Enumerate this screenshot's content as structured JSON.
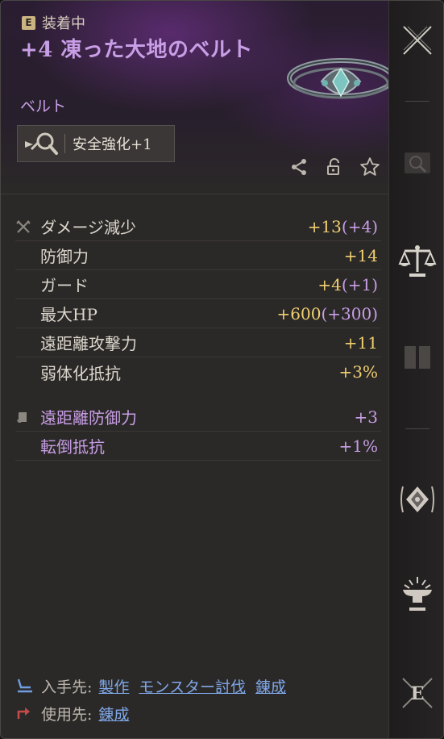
{
  "header": {
    "equipped_badge": "E",
    "equipped_label": "装着中",
    "item_name": "+4 凍った大地のベルト",
    "category": "ベルト",
    "enhance_label": "安全強化+1"
  },
  "action_icons": [
    "share-icon",
    "unlock-icon",
    "favorite-star-icon"
  ],
  "stats": [
    {
      "label": "ダメージ減少",
      "value": "+13",
      "bonus": "(+4)",
      "icon": "crossed-swords-icon"
    },
    {
      "label": "防御力",
      "value": "+14",
      "bonus": ""
    },
    {
      "label": "ガード",
      "value": "+4",
      "bonus": "(+1)"
    },
    {
      "label": "最大HP",
      "value": "+600",
      "bonus": "(+300)"
    },
    {
      "label": "遠距離攻撃力",
      "value": "+11",
      "bonus": ""
    },
    {
      "label": "弱体化抵抗",
      "value": "+3%",
      "bonus": ""
    }
  ],
  "sub_stats": [
    {
      "label": "遠距離防御力",
      "value": "+3",
      "icon": "scroll-icon"
    },
    {
      "label": "転倒抵抗",
      "value": "+1%"
    }
  ],
  "footer": {
    "source_label": "入手先:",
    "source_links": [
      "製作",
      "モンスター討伐",
      "錬成"
    ],
    "use_label": "使用先:",
    "use_links": [
      "錬成"
    ]
  },
  "sidebar_icons": [
    "close-icon",
    "search-icon",
    "compare-scales-icon",
    "book-icon",
    "cube-icon",
    "anvil-icon",
    "equip-e-icon"
  ],
  "colors": {
    "item_purple": "#c89ee6",
    "value_gold": "#f0cf70",
    "link_blue": "#7fa7e8",
    "panel_bg": "#2b2928"
  }
}
